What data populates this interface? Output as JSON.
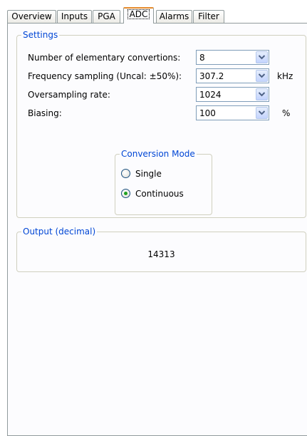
{
  "tabs": [
    {
      "label": "Overview",
      "selected": false
    },
    {
      "label": "Inputs",
      "selected": false
    },
    {
      "label": "PGA",
      "selected": false
    },
    {
      "label": "ADC",
      "selected": true
    },
    {
      "label": "Alarms",
      "selected": false
    },
    {
      "label": "Filter",
      "selected": false
    }
  ],
  "settings": {
    "title": "Settings",
    "rows": [
      {
        "label": "Number of elementary convertions:",
        "value": "8",
        "unit": ""
      },
      {
        "label": "Frequency sampling (Uncal: ±50%):",
        "value": "307.2",
        "unit": "kHz"
      },
      {
        "label": "Oversampling rate:",
        "value": "1024",
        "unit": ""
      },
      {
        "label": "Biasing:",
        "value": "100",
        "unit": "%"
      }
    ],
    "conversion_mode": {
      "title": "Conversion Mode",
      "options": [
        {
          "label": "Single",
          "selected": false
        },
        {
          "label": "Continuous",
          "selected": true
        }
      ]
    }
  },
  "output": {
    "title": "Output (decimal)",
    "value": "14313"
  },
  "colors": {
    "group_title": "#0046d5",
    "selected_tab_accent": "#e68b2c",
    "radio_dot": "#21a121"
  },
  "icons": {
    "combo_arrow": "chevron-down-icon"
  }
}
